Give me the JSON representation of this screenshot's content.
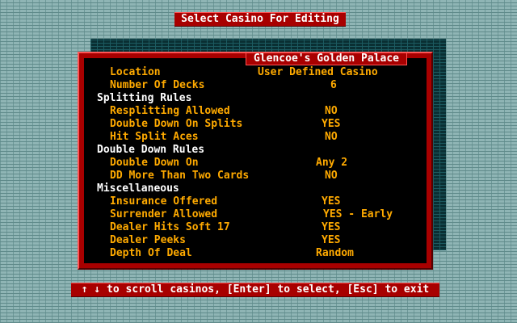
{
  "title": "Select Casino For Editing",
  "casino_name": "Glencoe's Golden Palace",
  "rows": [
    {
      "type": "item",
      "label": "Location",
      "value": "User Defined Casino"
    },
    {
      "type": "item",
      "label": "Number Of Decks",
      "value": "6"
    },
    {
      "type": "section",
      "label": "Splitting Rules",
      "value": ""
    },
    {
      "type": "item",
      "label": "Resplitting Allowed",
      "value": "NO"
    },
    {
      "type": "item",
      "label": "Double Down On Splits",
      "value": "YES"
    },
    {
      "type": "item",
      "label": "Hit Split Aces",
      "value": "NO"
    },
    {
      "type": "section",
      "label": "Double Down Rules",
      "value": ""
    },
    {
      "type": "item",
      "label": "Double Down On",
      "value": "Any 2"
    },
    {
      "type": "item",
      "label": "DD More Than Two Cards",
      "value": "NO"
    },
    {
      "type": "section",
      "label": "Miscellaneous",
      "value": ""
    },
    {
      "type": "item",
      "label": "Insurance Offered",
      "value": "YES"
    },
    {
      "type": "item",
      "label": "Surrender Allowed",
      "value": "YES - Early"
    },
    {
      "type": "item",
      "label": "Dealer Hits Soft 17",
      "value": "YES"
    },
    {
      "type": "item",
      "label": "Dealer Peeks",
      "value": "YES"
    },
    {
      "type": "item",
      "label": "Depth Of Deal",
      "value": "Random"
    }
  ],
  "status_bar": "↑ ↓ to scroll casinos, [Enter] to select, [Esc] to exit",
  "colors": {
    "background": "#8fb5b5",
    "frame": "#a80000",
    "panel": "#000000",
    "label_text": "#ffaa00",
    "section_text": "#ffffff"
  }
}
